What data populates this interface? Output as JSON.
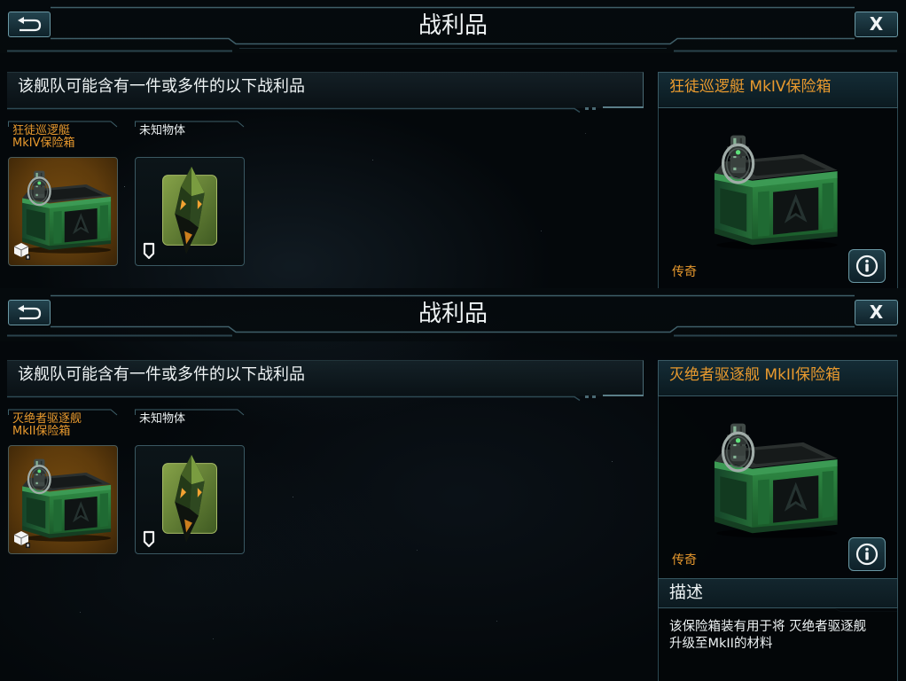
{
  "colors": {
    "accent_orange": "#e99a2e",
    "text_primary": "#e8eef0",
    "panel_border": "#3b5c66",
    "selected_card_bg": "#5e3b0c",
    "background": "#04080b"
  },
  "panels": [
    {
      "header": {
        "back_icon": "back-arrow-icon",
        "title": "战利品",
        "close_label": "X"
      },
      "loot_title": "该舰队可能含有一件或多件的以下战利品",
      "items": [
        {
          "label_lines": [
            "狂徒巡逻艇",
            "MkIV保险箱"
          ],
          "image": "chest-image",
          "badge_icon": "cube-icon",
          "selected": true
        },
        {
          "label_lines": [
            "未知物体"
          ],
          "image": "crystal-image",
          "badge_icon": "shield-icon",
          "selected": false
        }
      ],
      "detail": {
        "title": "狂徒巡逻艇 MkIV保险箱",
        "image": "chest-image",
        "rarity": "传奇",
        "info_icon": "info-icon"
      }
    },
    {
      "header": {
        "back_icon": "back-arrow-icon",
        "title": "战利品",
        "close_label": "X"
      },
      "loot_title": "该舰队可能含有一件或多件的以下战利品",
      "items": [
        {
          "label_lines": [
            "灭绝者驱逐舰",
            "MkII保险箱"
          ],
          "image": "chest-image",
          "badge_icon": "cube-icon",
          "selected": true
        },
        {
          "label_lines": [
            "未知物体"
          ],
          "image": "crystal-image",
          "badge_icon": "shield-icon",
          "selected": false
        }
      ],
      "detail": {
        "title": "灭绝者驱逐舰 MkII保险箱",
        "image": "chest-image",
        "rarity": "传奇",
        "info_icon": "info-icon"
      },
      "description": {
        "header": "描述",
        "lines": [
          "该保险箱装有用于将 灭绝者驱逐舰",
          "升级至MkII的材料"
        ]
      }
    }
  ]
}
